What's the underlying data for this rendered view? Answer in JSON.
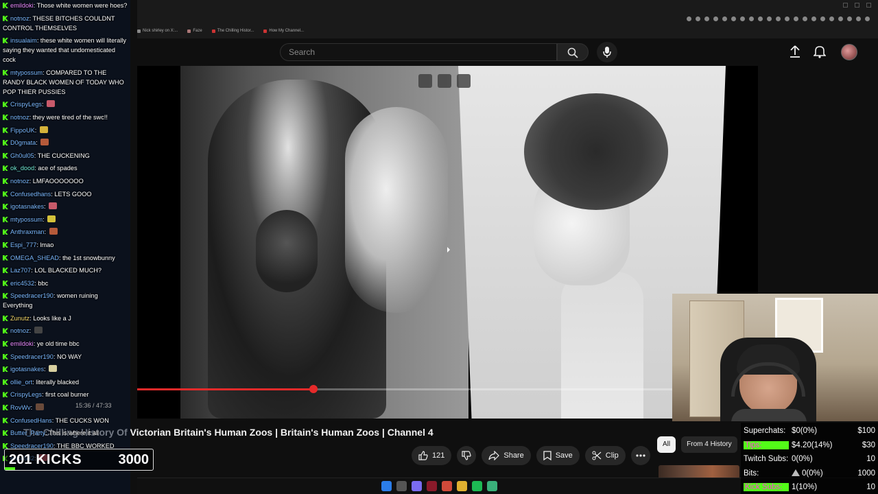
{
  "browser": {
    "bookmarks": [
      {
        "label": "Nick shirley on X:...",
        "color": "#888888"
      },
      {
        "label": "Faze",
        "color": "#aa7777"
      },
      {
        "label": "The Chilling Histor...",
        "color": "#cc3333"
      },
      {
        "label": "How My Channel...",
        "color": "#cc3333"
      }
    ]
  },
  "youtube": {
    "search_placeholder": "Search",
    "video_title": "The Chilling History Of Victorian Britain's Human Zoos | Britain's Human Zoos | Channel 4",
    "time": "15:36 / 47:33",
    "progress_fraction": 0.33,
    "likes": "121",
    "share_label": "Share",
    "save_label": "Save",
    "clip_label": "Clip",
    "chips": [
      "All",
      "From 4 History"
    ]
  },
  "chat": [
    {
      "user": "emildoki",
      "msg": "Those white women were hoes?",
      "color": "pink"
    },
    {
      "user": "notnoz",
      "msg": "THESE BITCHES COULDNT CONTROL THEMSELVES",
      "color": "blue"
    },
    {
      "user": "insualaim",
      "msg": "these white women will literally saying they wanted that undomesticated cock",
      "color": "blue"
    },
    {
      "user": "mtypossum",
      "msg": "COMPARED TO THE RANDY BLACK WOMEN OF TODAY WHO POP THIER PUSSIES",
      "color": "blue"
    },
    {
      "user": "CrispyLegs",
      "msg": "",
      "emote": "#c85a6a",
      "color": "blue"
    },
    {
      "user": "notnoz",
      "msg": "they were tired of the swc!!",
      "color": "blue"
    },
    {
      "user": "FippoUK",
      "msg": "",
      "emote": "#d4b23a",
      "color": "blue"
    },
    {
      "user": "D0gmata",
      "msg": "",
      "emote": "#b55a3a",
      "color": "blue"
    },
    {
      "user": "Gh0ul05",
      "msg": "THE CUCKENING",
      "color": "blue"
    },
    {
      "user": "ok_dood",
      "msg": "ace of spades",
      "color": "teal"
    },
    {
      "user": "notnoz",
      "msg": "LMFAOOOOOOO",
      "color": "blue"
    },
    {
      "user": "Confusedhans",
      "msg": "LETS GOOO",
      "color": "blue"
    },
    {
      "user": "igotasnakes",
      "msg": "",
      "emote": "#c85a6a",
      "color": "blue"
    },
    {
      "user": "mtypossum",
      "msg": "",
      "emote": "#d4c23a",
      "color": "blue"
    },
    {
      "user": "Anthraxman",
      "msg": "",
      "emote": "#b55a3a",
      "color": "blue"
    },
    {
      "user": "Espi_777",
      "msg": "lmao",
      "color": "blue"
    },
    {
      "user": "OMEGA_SHEAD",
      "msg": "the 1st snowbunny",
      "color": "blue"
    },
    {
      "user": "Laz707",
      "msg": "LOL BLACKED MUCH?",
      "color": "blue"
    },
    {
      "user": "eric4532",
      "msg": "bbc",
      "color": "blue"
    },
    {
      "user": "Speedracer190",
      "msg": "women ruining Everything",
      "color": "blue"
    },
    {
      "user": "Zunutz",
      "msg": "Looks like a J",
      "color": "yellow"
    },
    {
      "user": "notnoz",
      "msg": "",
      "emote": "#444444",
      "color": "blue"
    },
    {
      "user": "emildoki",
      "msg": "ye old time bbc",
      "color": "pink"
    },
    {
      "user": "Speedracer190",
      "msg": "NO WAY",
      "color": "blue"
    },
    {
      "user": "igotasnakes",
      "msg": "",
      "emote": "#d8d0a0",
      "color": "blue"
    },
    {
      "user": "ollie_ort",
      "msg": "literally blacked",
      "color": "blue"
    },
    {
      "user": "CrispyLegs",
      "msg": "first coal burner",
      "color": "blue"
    },
    {
      "user": "RovWv",
      "msg": "",
      "emote": "#6a4a3a",
      "color": "blue"
    },
    {
      "user": "ConfusedHans",
      "msg": "THE CUCKS WON",
      "color": "blue"
    },
    {
      "user": "Butter_Party",
      "msg": "This is where it all",
      "color": "blue"
    },
    {
      "user": "Speedracer190",
      "msg": "THE BBC WORKED",
      "color": "blue"
    },
    {
      "user": "eric4532",
      "msg": "",
      "emote": "#c85a6a",
      "color": "blue"
    }
  ],
  "kicks": {
    "count": "201",
    "label": "KICKS",
    "goal": "3000",
    "fraction": 0.067
  },
  "stats": [
    {
      "label": "Superchats:",
      "value": "$0(0%)",
      "goal": "$100",
      "highlight": false
    },
    {
      "label": "Tips:",
      "value": "$4.20(14%)",
      "goal": "$30",
      "highlight": true
    },
    {
      "label": "Twitch Subs:",
      "value": "0(0%)",
      "goal": "10",
      "highlight": false
    },
    {
      "label": "Bits:",
      "value": "0(0%)",
      "goal": "1000",
      "highlight": false,
      "icon": "bits-icon"
    },
    {
      "label": "Kick Subs:",
      "value": "1(10%)",
      "goal": "10",
      "highlight": true
    }
  ],
  "colors": {
    "kick_green": "#53fc18",
    "yt_red": "#e62a2a",
    "yt_bg": "#0f0f0f"
  }
}
